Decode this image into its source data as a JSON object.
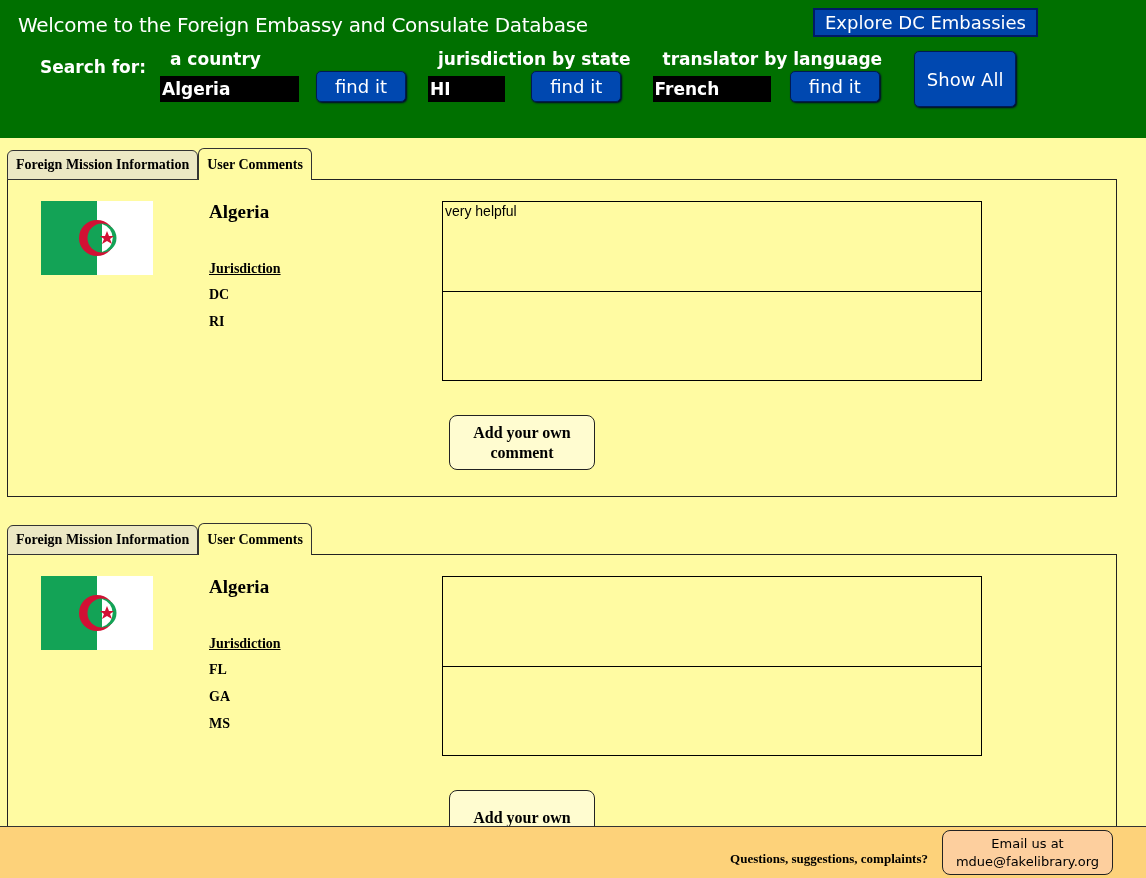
{
  "header": {
    "title": "Welcome to the Foreign Embassy and Consulate Database",
    "explore_button": "Explore DC Embassies",
    "search_label": "Search for:",
    "searches": [
      {
        "label": "a country",
        "value": "Algeria",
        "button": "find it"
      },
      {
        "label": "jurisdiction by state",
        "value": "HI",
        "button": "find it"
      },
      {
        "label": "translator by language",
        "value": "French",
        "button": "find it"
      }
    ],
    "show_all_button": "Show All"
  },
  "records": [
    {
      "tabs": [
        {
          "label": "Foreign Mission Information",
          "selected": false
        },
        {
          "label": "User Comments",
          "selected": true
        }
      ],
      "country": "Algeria",
      "jurisdiction_heading": "Jurisdiction",
      "jurisdictions": [
        "DC",
        "RI"
      ],
      "comments": [
        {
          "kind": "filled",
          "text": "very helpful"
        },
        {
          "kind": "empty"
        }
      ],
      "add_button": "Add your own comment"
    },
    {
      "tabs": [
        {
          "label": "Foreign Mission Information",
          "selected": false
        },
        {
          "label": "User Comments",
          "selected": true
        }
      ],
      "country": "Algeria",
      "jurisdiction_heading": "Jurisdiction",
      "jurisdictions": [
        "FL",
        "GA",
        "MS"
      ],
      "comments": [
        {
          "kind": "empty"
        },
        {
          "kind": "empty"
        }
      ],
      "add_button": "Add your own"
    }
  ],
  "footer": {
    "text": "Questions, suggestions, complaints?",
    "email_button": "Email us at mdue@fakelibrary.org"
  }
}
